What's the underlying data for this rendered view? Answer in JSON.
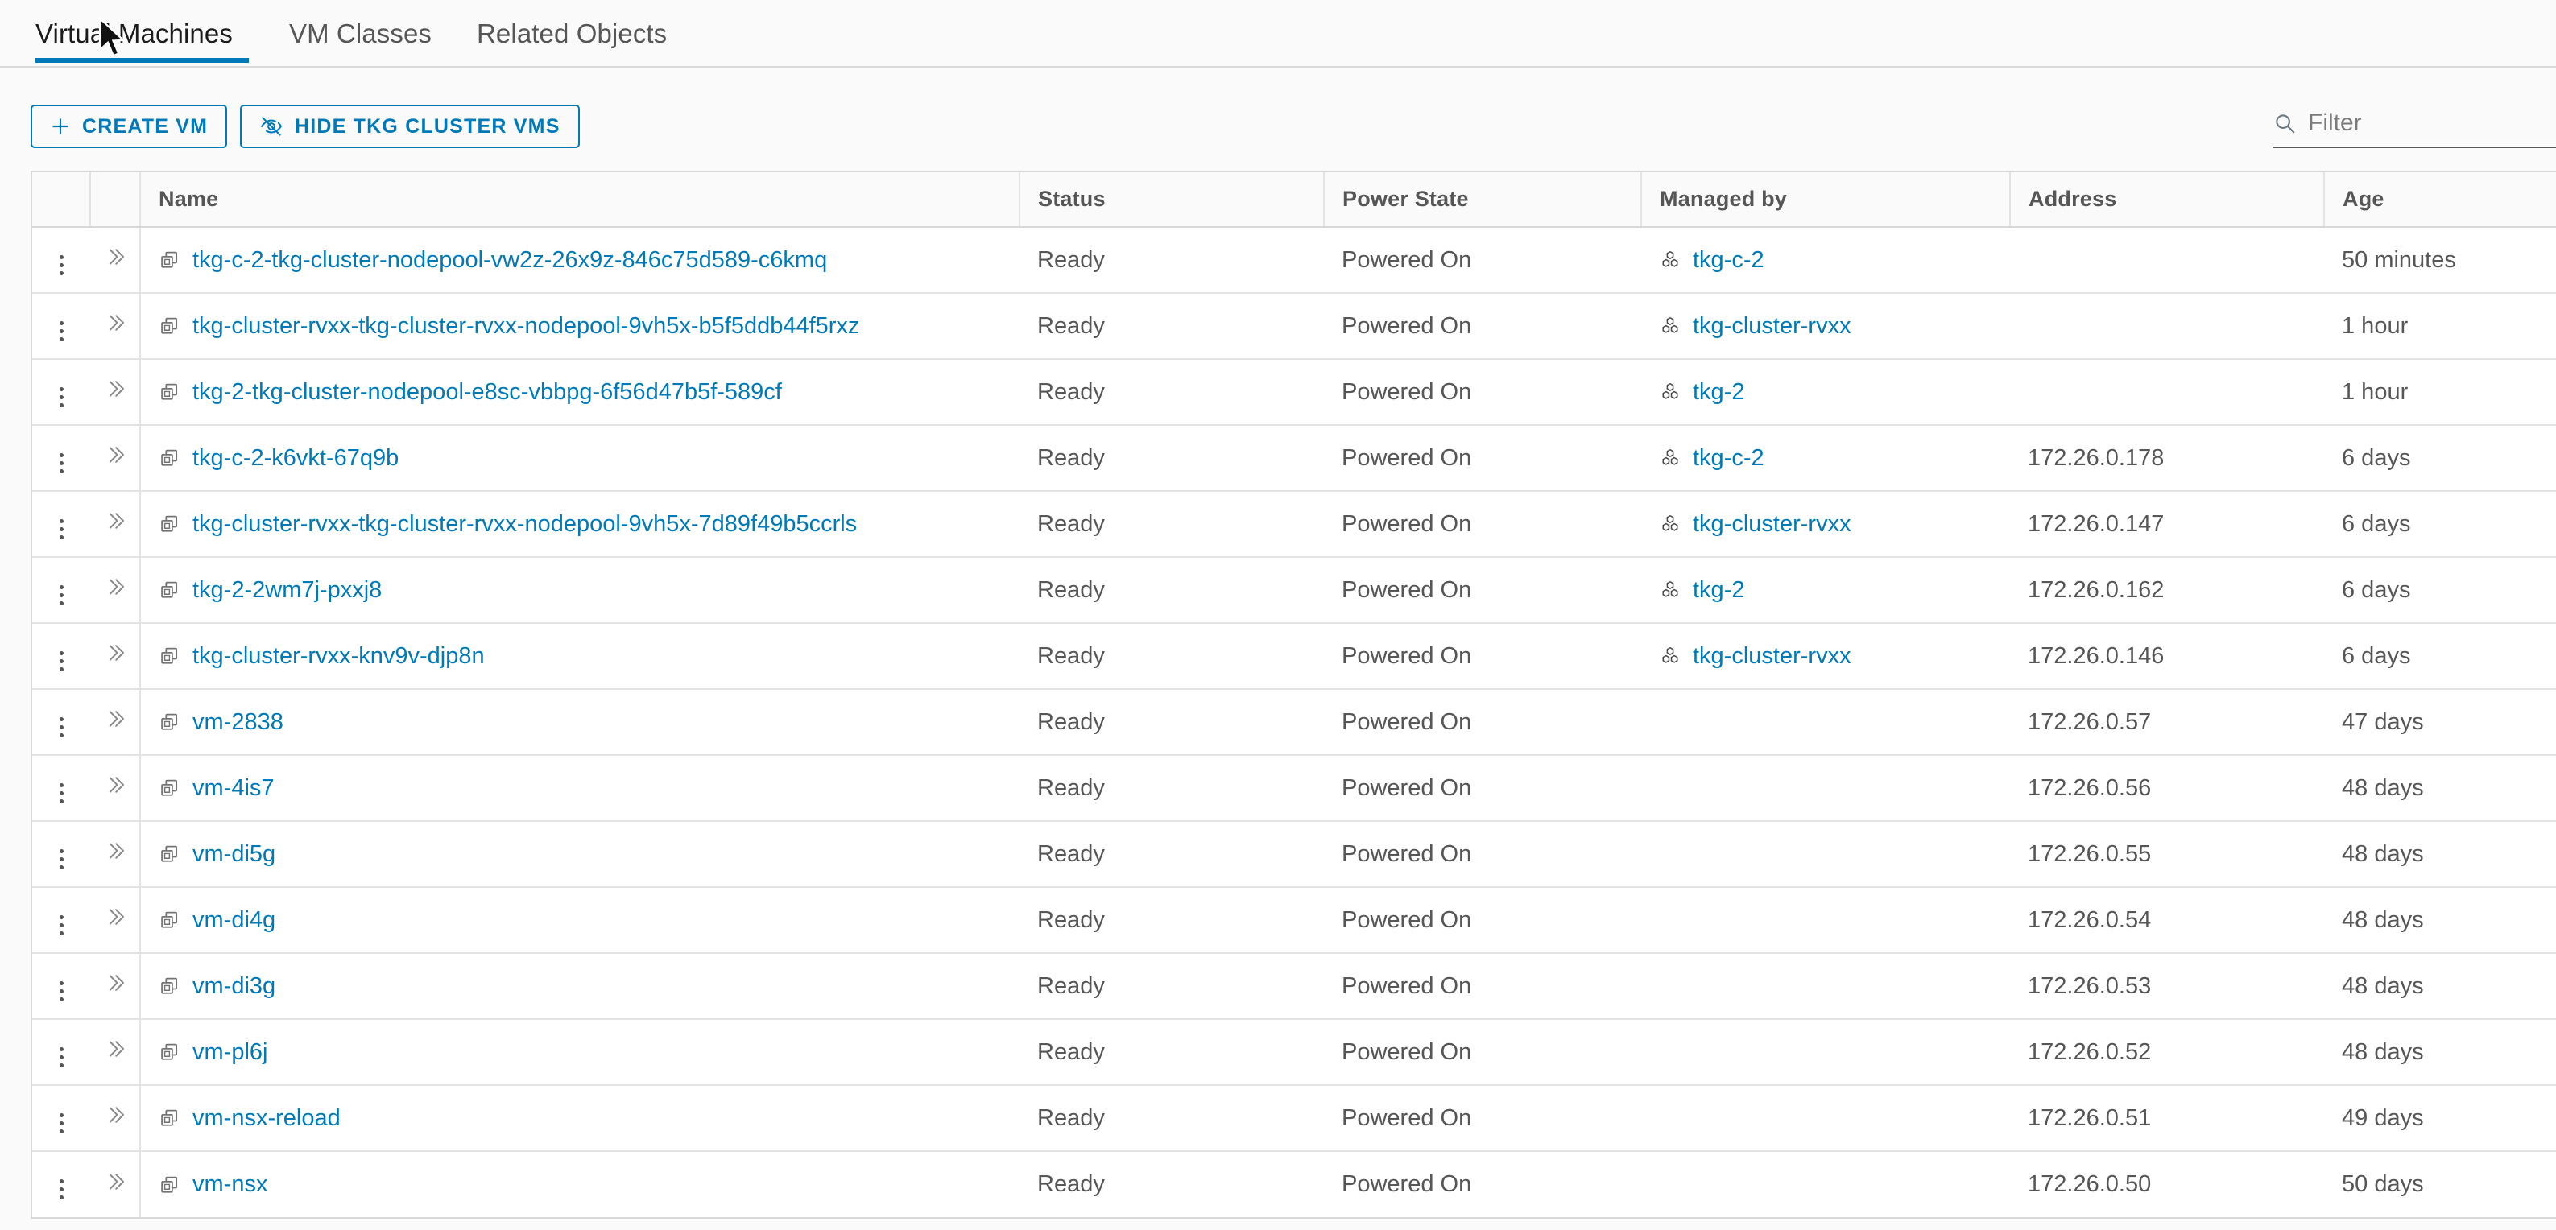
{
  "tabs": [
    {
      "label": "Virtual Machines",
      "active": true
    },
    {
      "label": "VM Classes",
      "active": false
    },
    {
      "label": "Related Objects",
      "active": false
    }
  ],
  "toolbar": {
    "create_vm_label": "CREATE VM",
    "hide_tkg_label": "HIDE TKG CLUSTER VMS",
    "create_icon": "plus-icon",
    "hide_icon": "eye-slash-icon"
  },
  "search": {
    "placeholder": "Filter",
    "value": "",
    "icon": "search-icon"
  },
  "table": {
    "columns": [
      "",
      "",
      "Name",
      "Status",
      "Power State",
      "Managed by",
      "Address",
      "Age"
    ],
    "row_icon": "virtual-machine-icon",
    "managed_by_icon": "cluster-icon",
    "rows": [
      {
        "name": "tkg-c-2-tkg-cluster-nodepool-vw2z-26x9z-846c75d589-c6kmq",
        "status": "Ready",
        "power_state": "Powered On",
        "managed_by": "tkg-c-2",
        "address": "",
        "age": "50 minutes"
      },
      {
        "name": "tkg-cluster-rvxx-tkg-cluster-rvxx-nodepool-9vh5x-b5f5ddb44f5rxz",
        "status": "Ready",
        "power_state": "Powered On",
        "managed_by": "tkg-cluster-rvxx",
        "address": "",
        "age": "1 hour"
      },
      {
        "name": "tkg-2-tkg-cluster-nodepool-e8sc-vbbpg-6f56d47b5f-589cf",
        "status": "Ready",
        "power_state": "Powered On",
        "managed_by": "tkg-2",
        "address": "",
        "age": "1 hour"
      },
      {
        "name": "tkg-c-2-k6vkt-67q9b",
        "status": "Ready",
        "power_state": "Powered On",
        "managed_by": "tkg-c-2",
        "address": "172.26.0.178",
        "age": "6 days"
      },
      {
        "name": "tkg-cluster-rvxx-tkg-cluster-rvxx-nodepool-9vh5x-7d89f49b5ccrls",
        "status": "Ready",
        "power_state": "Powered On",
        "managed_by": "tkg-cluster-rvxx",
        "address": "172.26.0.147",
        "age": "6 days"
      },
      {
        "name": "tkg-2-2wm7j-pxxj8",
        "status": "Ready",
        "power_state": "Powered On",
        "managed_by": "tkg-2",
        "address": "172.26.0.162",
        "age": "6 days"
      },
      {
        "name": "tkg-cluster-rvxx-knv9v-djp8n",
        "status": "Ready",
        "power_state": "Powered On",
        "managed_by": "tkg-cluster-rvxx",
        "address": "172.26.0.146",
        "age": "6 days"
      },
      {
        "name": "vm-2838",
        "status": "Ready",
        "power_state": "Powered On",
        "managed_by": "",
        "address": "172.26.0.57",
        "age": "47 days"
      },
      {
        "name": "vm-4is7",
        "status": "Ready",
        "power_state": "Powered On",
        "managed_by": "",
        "address": "172.26.0.56",
        "age": "48 days"
      },
      {
        "name": "vm-di5g",
        "status": "Ready",
        "power_state": "Powered On",
        "managed_by": "",
        "address": "172.26.0.55",
        "age": "48 days"
      },
      {
        "name": "vm-di4g",
        "status": "Ready",
        "power_state": "Powered On",
        "managed_by": "",
        "address": "172.26.0.54",
        "age": "48 days"
      },
      {
        "name": "vm-di3g",
        "status": "Ready",
        "power_state": "Powered On",
        "managed_by": "",
        "address": "172.26.0.53",
        "age": "48 days"
      },
      {
        "name": "vm-pl6j",
        "status": "Ready",
        "power_state": "Powered On",
        "managed_by": "",
        "address": "172.26.0.52",
        "age": "48 days"
      },
      {
        "name": "vm-nsx-reload",
        "status": "Ready",
        "power_state": "Powered On",
        "managed_by": "",
        "address": "172.26.0.51",
        "age": "49 days"
      },
      {
        "name": "vm-nsx",
        "status": "Ready",
        "power_state": "Powered On",
        "managed_by": "",
        "address": "172.26.0.50",
        "age": "50 days"
      }
    ]
  },
  "colors": {
    "accent": "#0079b8",
    "text": "#565656",
    "text_strong": "#1b1b1b",
    "border": "#d8d8d8",
    "row_border": "#e3e3e3",
    "page_bg": "#fafafa",
    "table_bg": "#ffffff"
  }
}
